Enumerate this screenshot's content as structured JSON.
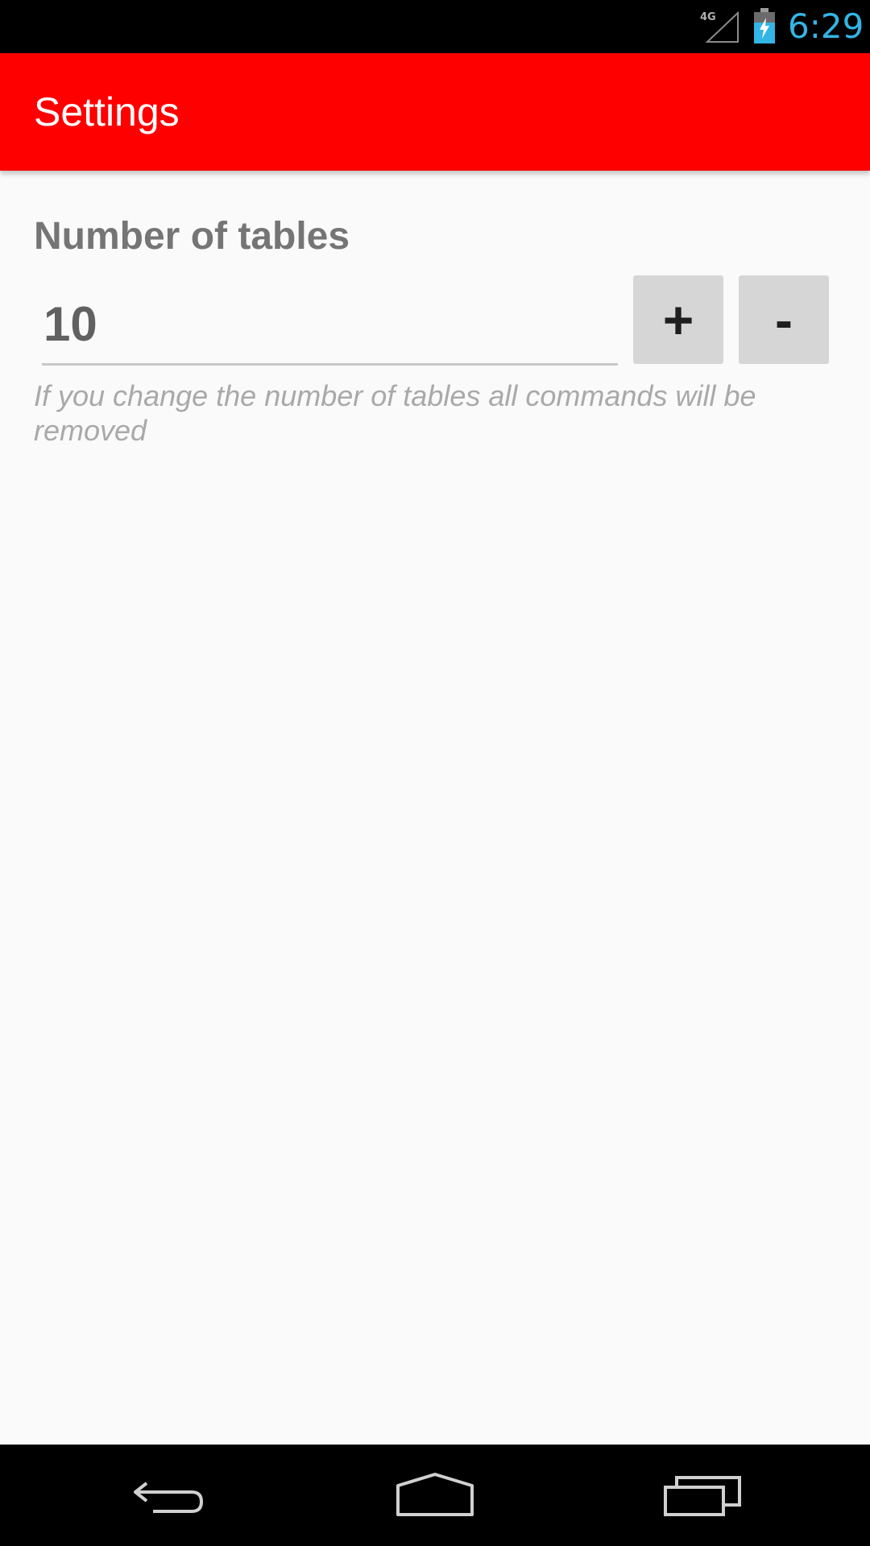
{
  "status_bar": {
    "network_label": "4G",
    "network_icon": "signal-icon",
    "battery_icon": "battery-charging-icon",
    "time": "6:29",
    "time_color": "#33b5e5"
  },
  "app_bar": {
    "title": "Settings",
    "color": "#ff0000"
  },
  "settings": {
    "section_title": "Number of tables",
    "tables_value": "10",
    "plus_label": "+",
    "minus_label": "-",
    "hint": "If you change the number of tables all commands will be removed"
  },
  "nav_bar": {
    "back_icon": "back-icon",
    "home_icon": "home-icon",
    "recents_icon": "recent-apps-icon"
  }
}
